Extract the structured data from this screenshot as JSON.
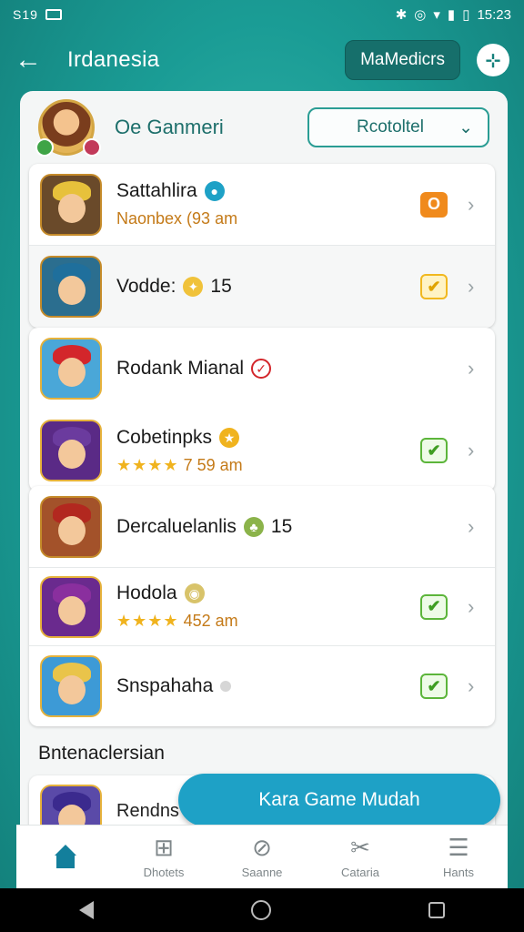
{
  "status_bar": {
    "left_text": "S19",
    "time": "15:23"
  },
  "app_bar": {
    "title": "Irdanesia",
    "chip_label": "MaMedicrs",
    "round_icon": "pin-icon"
  },
  "profile": {
    "name": "Oe Ganmeri",
    "dropdown_value": "Rcotoltel"
  },
  "groups": [
    {
      "rows": [
        {
          "title": "Sattahlira",
          "sub": "Naonbex (93 am",
          "status": "orange",
          "status_glyph": "O",
          "badge": "info",
          "hair": "#e7c13b"
        },
        {
          "title": "Vodde:",
          "extra": "15",
          "status": "yellow",
          "status_glyph": "✔",
          "badge": "coin",
          "hair": "#1f6f9c"
        }
      ]
    },
    {
      "rows": [
        {
          "title": "Rodank Mianal",
          "status": "none",
          "badge": "red-check",
          "hair": "#d3262b"
        },
        {
          "title": "Cobetinpks",
          "sub_stars": "★★★★",
          "sub": "7 59 am",
          "status": "green",
          "status_glyph": "✔",
          "badge": "gold",
          "hair": "#6b3b9e"
        }
      ]
    },
    {
      "rows": [
        {
          "title": "Dercaluelanlis",
          "extra": "15",
          "status": "none",
          "badge": "leaf",
          "hair": "#b2281f"
        },
        {
          "title": "Hodola",
          "sub_stars": "★★★★",
          "sub": "452 am",
          "status": "green",
          "status_glyph": "✔",
          "badge": "cookie",
          "hair": "#8a2f9e"
        },
        {
          "title": "Snspahaha",
          "status": "green",
          "status_glyph": "✔",
          "badge": "dot",
          "hair": "#e9c44a"
        }
      ]
    }
  ],
  "section_label": "Bntenaclersian",
  "partial_row": {
    "title": "Rendns"
  },
  "fab_label": "Kara Game Mudah",
  "bottom_nav": [
    {
      "label": "",
      "icon": "home-icon",
      "active": true
    },
    {
      "label": "Dhotets",
      "icon": "controller-icon"
    },
    {
      "label": "Saanne",
      "icon": "compass-icon"
    },
    {
      "label": "Cataria",
      "icon": "tools-icon"
    },
    {
      "label": "Hants",
      "icon": "menu-icon"
    }
  ],
  "colors": {
    "accent": "#1a9c95",
    "fab": "#1ea1c6",
    "star": "#f0b31e"
  }
}
